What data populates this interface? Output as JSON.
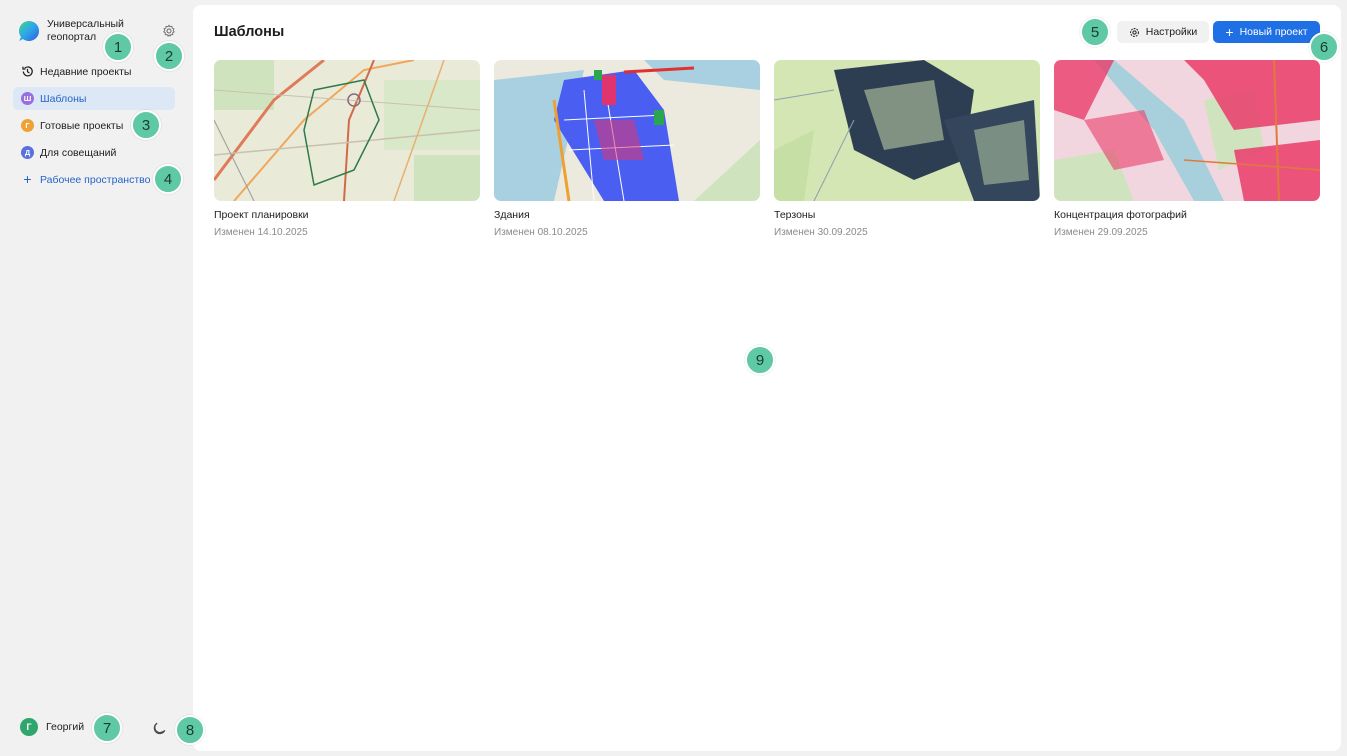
{
  "app": {
    "name": "Универсальный геопортал"
  },
  "sidebar": {
    "items": [
      {
        "label": "Недавние проекты",
        "icon": "history-icon"
      },
      {
        "label": "Шаблоны",
        "badge": "Ш",
        "badge_color": "#9b6ee0",
        "active": true
      },
      {
        "label": "Готовые проекты",
        "badge": "Г",
        "badge_color": "#f0a134"
      },
      {
        "label": "Для совещаний",
        "badge": "Д",
        "badge_color": "#5a6fe0"
      }
    ],
    "add_workspace": "Рабочее пространство",
    "user": {
      "initial": "Г",
      "name": "Георгий"
    }
  },
  "main": {
    "title": "Шаблоны",
    "settings_label": "Настройки",
    "new_project_label": "Новый проект",
    "cards": [
      {
        "title": "Проект планировки",
        "date": "Изменен 14.10.2025"
      },
      {
        "title": "Здания",
        "date": "Изменен 08.10.2025"
      },
      {
        "title": "Терзоны",
        "date": "Изменен 30.09.2025"
      },
      {
        "title": "Концентрация фотографий",
        "date": "Изменен 29.09.2025"
      }
    ]
  },
  "markers": [
    "1",
    "2",
    "3",
    "4",
    "5",
    "6",
    "7",
    "8",
    "9"
  ],
  "colors": {
    "accent": "#1f6fe5",
    "active_bg": "#dde8f6",
    "marker": "#5ec9a4"
  }
}
